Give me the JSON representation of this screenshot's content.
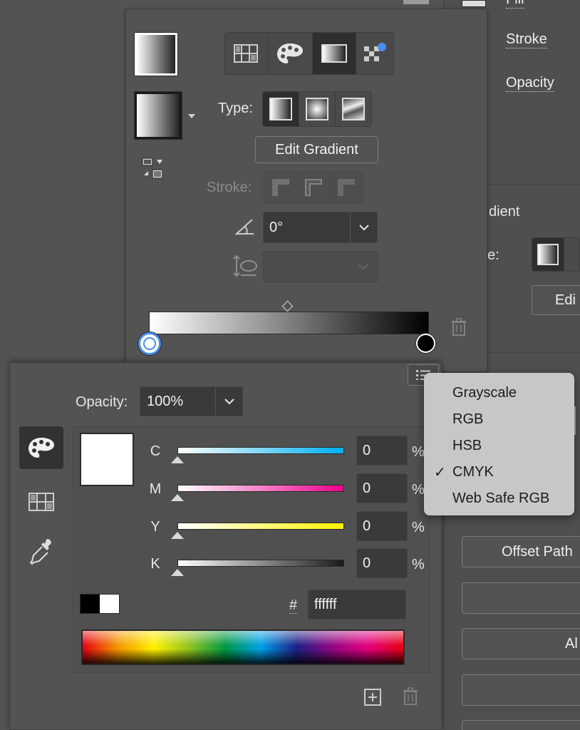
{
  "background_panel": {
    "fill_label": "Fill",
    "stroke_label": "Stroke",
    "opacity_label": "Opacity",
    "gradient_heading": "dient",
    "type_label": "e:",
    "edit_button": "Edi",
    "offset_path_button": "Offset Path",
    "align_button": "Al"
  },
  "gradient_panel": {
    "type_label": "Type:",
    "edit_gradient_button": "Edit Gradient",
    "stroke_label": "Stroke:",
    "angle_value": "0°",
    "gradient_mode_tabs": [
      "swatches-grid-icon",
      "color-palette-icon",
      "gradient-icon",
      "pattern-icon"
    ],
    "active_tab": "gradient"
  },
  "color_panel": {
    "opacity_label": "Opacity:",
    "opacity_value": "100%",
    "channels": [
      {
        "label": "C",
        "value": "0",
        "unit": "%"
      },
      {
        "label": "M",
        "value": "0",
        "unit": "%"
      },
      {
        "label": "Y",
        "value": "0",
        "unit": "%"
      },
      {
        "label": "K",
        "value": "0",
        "unit": "%"
      }
    ],
    "hex_label": "#",
    "hex_value": "ffffff",
    "current_color": "#ffffff"
  },
  "color_mode_menu": {
    "items": [
      "Grayscale",
      "RGB",
      "HSB",
      "CMYK",
      "Web Safe RGB"
    ],
    "checked": "CMYK",
    "check_glyph": "✓"
  },
  "colors": {
    "panel_bg": "#535353",
    "accent_blue": "#4a8df0",
    "cyan": "#00aeef",
    "magenta": "#ec008c",
    "yellow": "#fff200"
  }
}
